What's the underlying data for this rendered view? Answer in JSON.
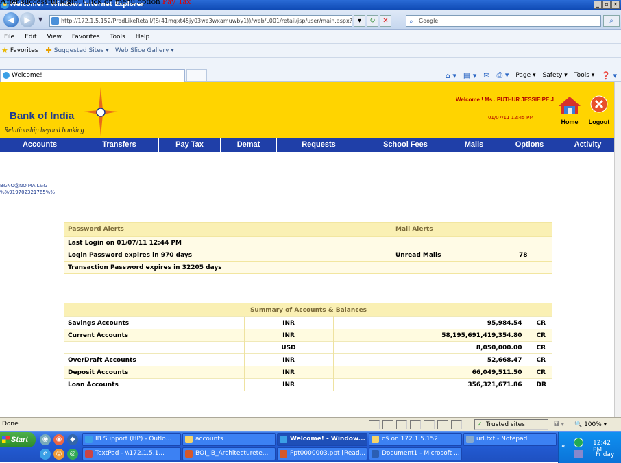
{
  "caption": {
    "prefix": "After successful login. Click on menu option ",
    "highlight": "Pay Tax"
  },
  "window": {
    "title": "Welcome! - Windows Internet Explorer"
  },
  "address": {
    "url": "http://172.1.5.152/ProdLikeRetail/(S(41mqxt45jy03we3wxamuwby1))/web/L001/retail/jsp/user/main.aspx?Requ",
    "search_placeholder": "Google"
  },
  "menubar": [
    "File",
    "Edit",
    "View",
    "Favorites",
    "Tools",
    "Help"
  ],
  "favbar": {
    "favorites": "Favorites",
    "suggested": "Suggested Sites ▾",
    "webslice": "Web Slice Gallery ▾"
  },
  "tab": {
    "label": "Welcome!"
  },
  "cmdbar": {
    "page": "Page ▾",
    "safety": "Safety ▾",
    "tools": "Tools ▾"
  },
  "bank": {
    "name": "Bank of India",
    "tagline": "Relationship beyond banking",
    "welcome": "Welcome ! Ms . PUTHUR JESSIEIPE J",
    "datetime": "01/07/11 12:45 PM",
    "home": "Home",
    "logout": "Logout"
  },
  "nav": [
    "Accounts",
    "Transfers",
    "Pay Tax",
    "Demat",
    "Requests",
    "School Fees",
    "Mails",
    "Options",
    "Activity"
  ],
  "userinfo": {
    "line1": "B&NO@NO.MAIL&&",
    "line2": "%%919702321765%%"
  },
  "alerts": {
    "password_header": "Password Alerts",
    "mail_header": "Mail Alerts",
    "last_login": "Last Login on 01/07/11 12:44 PM",
    "login_pw": "Login Password expires in 970 days",
    "txn_pw": "Transaction Password expires in 32205 days",
    "unread_label": "Unread Mails",
    "unread_count": "78"
  },
  "summary": {
    "title": "Summary of Accounts & Balances",
    "rows": [
      {
        "name": "Savings Accounts",
        "currency": "INR",
        "amount": "95,984.54",
        "ind": "CR"
      },
      {
        "name": "Current Accounts",
        "currency": "INR",
        "amount": "58,195,691,419,354.80",
        "ind": "CR"
      },
      {
        "name": "",
        "currency": "USD",
        "amount": "8,050,000.00",
        "ind": "CR"
      },
      {
        "name": "OverDraft Accounts",
        "currency": "INR",
        "amount": "52,668.47",
        "ind": "CR"
      },
      {
        "name": "Deposit Accounts",
        "currency": "INR",
        "amount": "66,049,511.50",
        "ind": "CR"
      },
      {
        "name": "Loan Accounts",
        "currency": "INR",
        "amount": "356,321,671.86",
        "ind": "DR"
      }
    ]
  },
  "status": {
    "text": "Done",
    "zone": "Trusted sites",
    "zoom": "100%"
  },
  "taskbar": {
    "start": "Start",
    "row1": [
      "IB Support (HP) - Outlo...",
      "accounts",
      "Welcome! - Window...",
      "c$ on 172.1.5.152",
      "url.txt - Notepad"
    ],
    "row2": [
      "TextPad - \\\\172.1.5.1...",
      "BOI_IB_Architecturete...",
      "Ppt0000003.ppt [Read...",
      "Document1 - Microsoft ..."
    ],
    "clock": "12:42 PM",
    "day": "Friday"
  }
}
